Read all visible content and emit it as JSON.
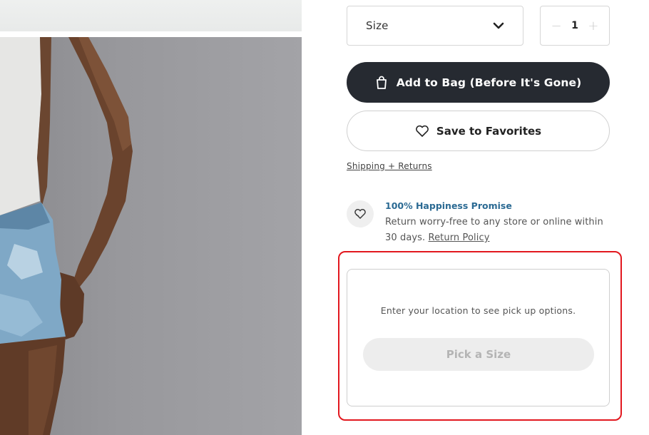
{
  "product": {
    "size_select": {
      "label": "Size",
      "icon": "chevron-down-icon"
    },
    "quantity": {
      "minus": "−",
      "value": "1",
      "plus": "+"
    },
    "add_to_bag": {
      "label": "Add to Bag (Before It's Gone)",
      "icon": "shopping-bag-icon"
    },
    "favorites": {
      "label": "Save to Favorites",
      "icon": "heart-icon"
    },
    "shipping_link": "Shipping + Returns"
  },
  "promise": {
    "icon": "heart-hands-icon",
    "title": "100% Happiness Promise",
    "text": "Return worry-free to any store or online within 30 days.",
    "link": "Return Policy"
  },
  "pickup": {
    "message": "Enter your location to see pick up options.",
    "button_label": "Pick a Size"
  },
  "colors": {
    "primary_button": "#262a31",
    "promise_title": "#2b6a93",
    "highlight": "#e2181f",
    "disabled_button": "#ededed"
  }
}
